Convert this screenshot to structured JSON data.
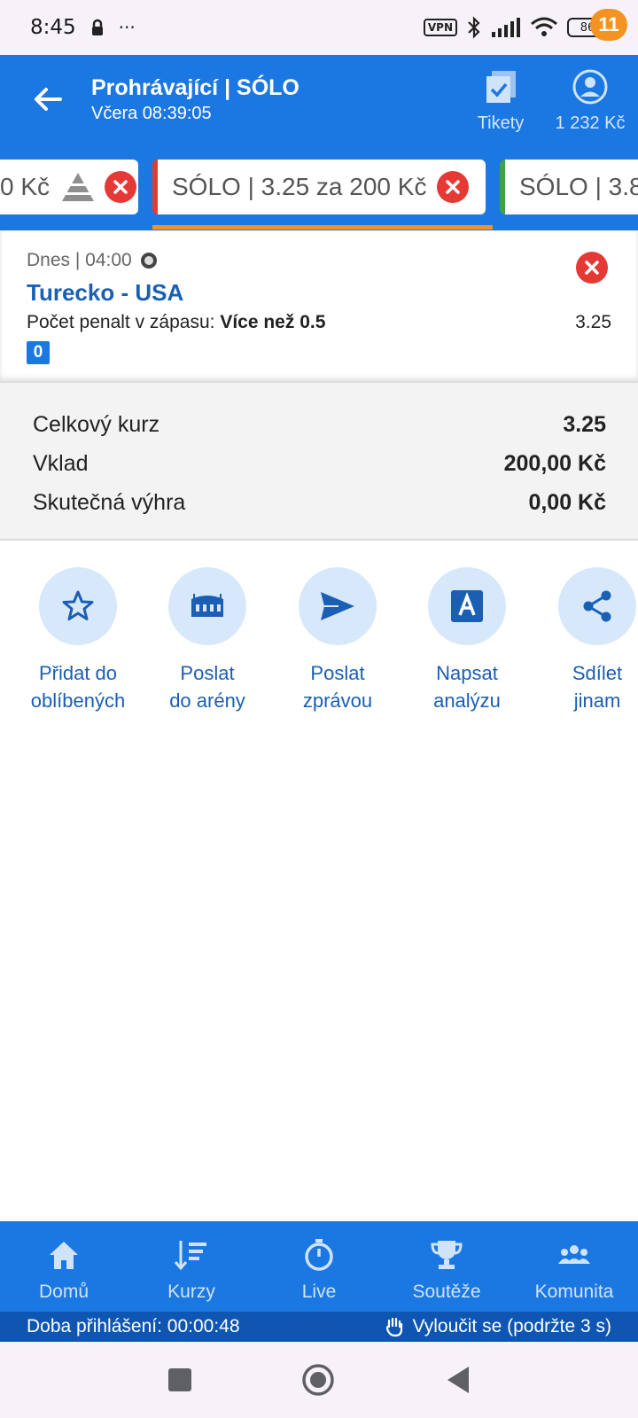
{
  "status_bar": {
    "time": "8:45",
    "dots": "···",
    "vpn": "VPN",
    "battery": "86"
  },
  "header": {
    "title": "Prohrávající | SÓLO",
    "subtitle": "Včera 08:39:05",
    "tickets_label": "Tikety",
    "balance": "1 232 Kč",
    "badge_count": "11"
  },
  "tabs": [
    {
      "label": "0 Kč"
    },
    {
      "label": "SÓLO  | 3.25 za 200 Kč"
    },
    {
      "label": "SÓLO  | 3.8"
    }
  ],
  "event": {
    "date": "Dnes | 04:00",
    "match": "Turecko - USA",
    "market_label": "Počet penalt v zápasu: ",
    "selection": "Více než 0.5",
    "odds": "3.25",
    "tag": "0"
  },
  "summary": {
    "total_odds_label": "Celkový kurz",
    "total_odds": "3.25",
    "stake_label": "Vklad",
    "stake": "200,00 Kč",
    "win_label": "Skutečná výhra",
    "win": "0,00 Kč"
  },
  "actions": [
    {
      "line1": "Přidat do",
      "line2": "oblíbených",
      "icon": "star-icon"
    },
    {
      "line1": "Poslat",
      "line2": "do arény",
      "icon": "arena-icon"
    },
    {
      "line1": "Poslat",
      "line2": "zprávou",
      "icon": "send-icon"
    },
    {
      "line1": "Napsat",
      "line2": "analýzu",
      "icon": "analysis-icon"
    },
    {
      "line1": "Sdílet",
      "line2": "jinam",
      "icon": "share-icon"
    }
  ],
  "bottom_nav": [
    {
      "label": "Domů",
      "icon": "home-icon"
    },
    {
      "label": "Kurzy",
      "icon": "odds-icon"
    },
    {
      "label": "Live",
      "icon": "stopwatch-icon"
    },
    {
      "label": "Soutěže",
      "icon": "trophy-icon"
    },
    {
      "label": "Komunita",
      "icon": "community-icon"
    }
  ],
  "info_bar": {
    "login_time": "Doba přihlášení: 00:00:48",
    "exclude": "Vyloučit se (podržte 3 s)"
  },
  "colors": {
    "primary": "#1b78e2",
    "accent": "#f39322",
    "danger": "#e53935",
    "link": "#1a5fb4"
  }
}
